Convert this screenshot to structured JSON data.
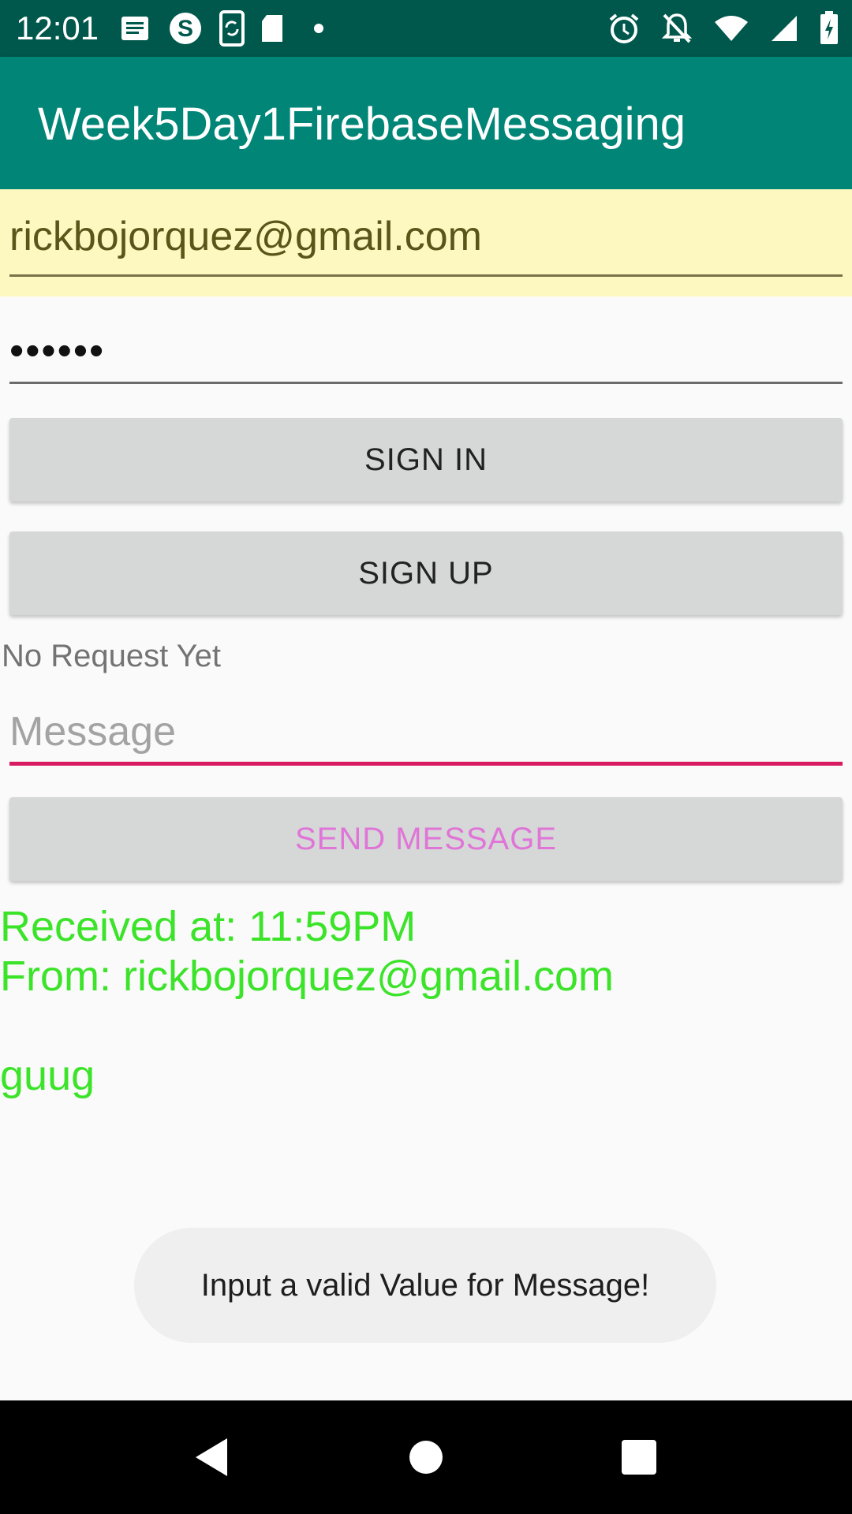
{
  "status_bar": {
    "time": "12:01",
    "left_icons": [
      "message-notification-icon",
      "skype-icon",
      "phone-sync-icon",
      "sd-card-icon",
      "dot-icon"
    ],
    "right_icons": [
      "alarm-icon",
      "notifications-off-icon",
      "wifi-icon",
      "signal-icon",
      "battery-charging-icon"
    ]
  },
  "app_bar": {
    "title": "Week5Day1FirebaseMessaging",
    "color": "#008577",
    "status_color": "#00574b"
  },
  "form": {
    "email_value": "rickbojorquez@gmail.com",
    "password_value": "••••••",
    "sign_in_label": "SIGN IN",
    "sign_up_label": "SIGN UP",
    "status_text": "No Request Yet",
    "message_value": "",
    "message_placeholder": "Message",
    "send_label": "SEND MESSAGE",
    "accent_color": "#d81b60"
  },
  "received": {
    "received_at": "Received at: 11:59PM",
    "from": "From: rickbojorquez@gmail.com",
    "body": "guug",
    "text_color": "#3be329"
  },
  "toast": {
    "text": "Input a valid Value for Message!"
  },
  "nav_bar": {
    "icons": [
      "back-icon",
      "home-icon",
      "recents-icon"
    ]
  }
}
